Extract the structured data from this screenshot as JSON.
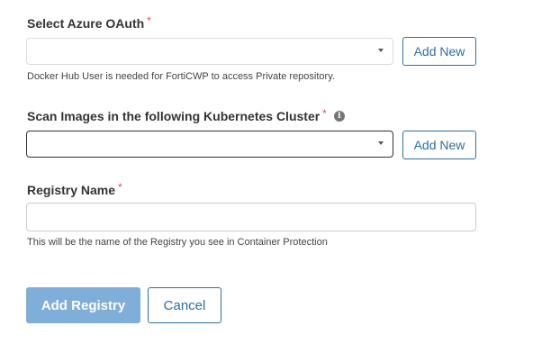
{
  "form": {
    "azure_oauth": {
      "label": "Select Azure OAuth",
      "required_marker": "*",
      "value": "",
      "add_new_label": "Add New",
      "help": "Docker Hub User is needed for FortiCWP to access Private repository."
    },
    "kubernetes_cluster": {
      "label": "Scan Images in the following Kubernetes Cluster",
      "required_marker": "*",
      "info_glyph": "i",
      "value": "",
      "add_new_label": "Add New"
    },
    "registry_name": {
      "label": "Registry Name",
      "required_marker": "*",
      "value": "",
      "help": "This will be the name of the Registry you see in Container Protection"
    },
    "actions": {
      "submit_label": "Add Registry",
      "cancel_label": "Cancel"
    }
  },
  "colors": {
    "accent": "#2e6e9e",
    "primary_disabled": "#7faed8",
    "required": "#d9534f"
  }
}
